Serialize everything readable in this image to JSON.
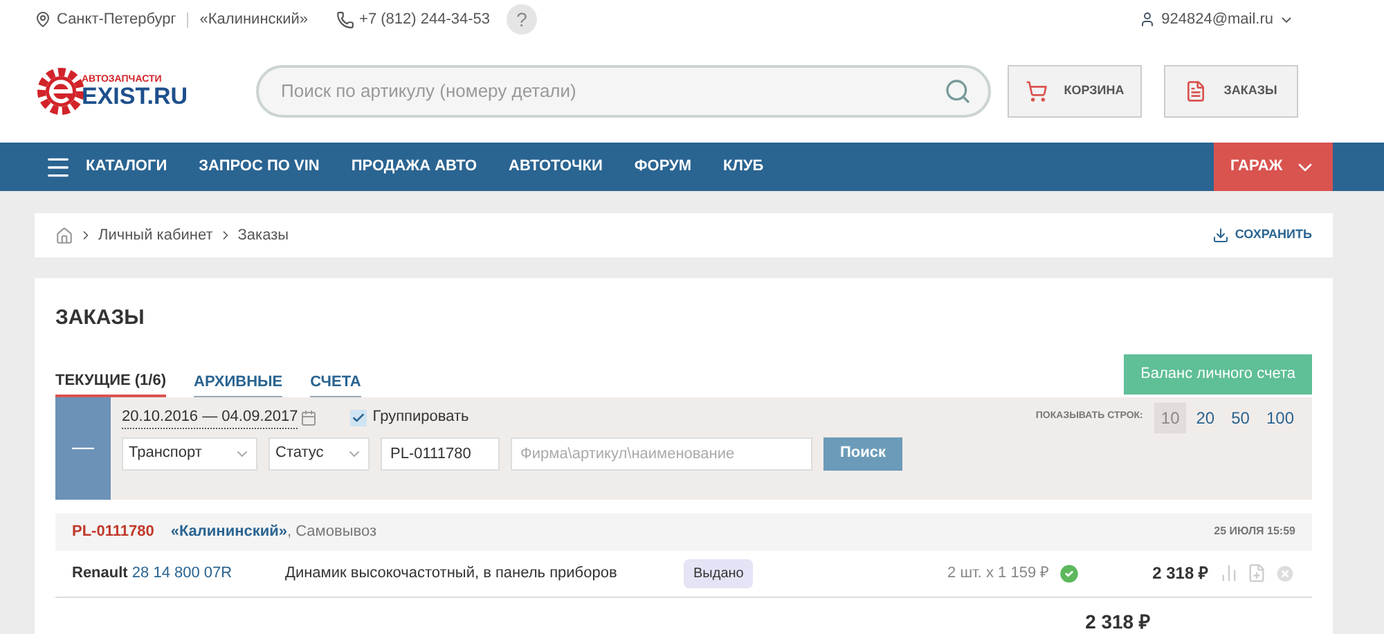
{
  "topbar": {
    "city": "Санкт-Петербург",
    "store": "«Калининский»",
    "phone": "+7 (812) 244-34-53",
    "help": "?",
    "user": "924824@mail.ru"
  },
  "logo": {
    "tagline": "АВТОЗАПЧАСТИ",
    "name": "EXIST.RU"
  },
  "search": {
    "placeholder": "Поиск по артикулу (номеру детали)"
  },
  "header_buttons": [
    {
      "kind": "cart",
      "label": "КОРЗИНА"
    },
    {
      "kind": "orders",
      "label": "ЗАКАЗЫ"
    }
  ],
  "nav": {
    "items": [
      "КАТАЛОГИ",
      "ЗАПРОС ПО VIN",
      "ПРОДАЖА АВТО",
      "АВТОТОЧКИ",
      "ФОРУМ",
      "КЛУБ"
    ],
    "garage": "ГАРАЖ"
  },
  "breadcrumbs": [
    "Личный кабинет",
    "Заказы"
  ],
  "save": "СОХРАНИТЬ",
  "page_title": "ЗАКАЗЫ",
  "tabs": [
    {
      "label": "ТЕКУЩИЕ (1/6)",
      "selected": true
    },
    {
      "label": "АРХИВНЫЕ",
      "selected": false
    },
    {
      "label": "СЧЕТА",
      "selected": false
    }
  ],
  "balance_button": "Баланс личного счета",
  "filters": {
    "collapse": "—",
    "date_range": "20.10.2016 — 04.09.2017",
    "group": {
      "label": "Группировать",
      "checked": true
    },
    "transport": "Транспорт",
    "status": "Статус",
    "order_number": "PL-0111780",
    "query_placeholder": "Фирма\\артикул\\наименование",
    "search_button": "Поиск",
    "rows_label": "ПОКАЗЫВАТЬ СТРОК:",
    "row_options": [
      {
        "label": "10",
        "selected": true
      },
      {
        "label": "20",
        "selected": false
      },
      {
        "label": "50",
        "selected": false
      },
      {
        "label": "100",
        "selected": false
      }
    ]
  },
  "order": {
    "number": "PL-0111780",
    "store": "«Калининский»",
    "delivery": ", Самовывоз",
    "date": "25 ИЮЛЯ 15:59",
    "items": [
      {
        "brand": "Renault",
        "article": "28 14 800 07R",
        "description": "Динамик высокочастотный, в панель приборов",
        "status": "Выдано",
        "quantity": "2 шт. x 1 159 ₽",
        "delivered": true,
        "sum": "2 318 ₽"
      }
    ],
    "total": "2 318 ₽"
  }
}
